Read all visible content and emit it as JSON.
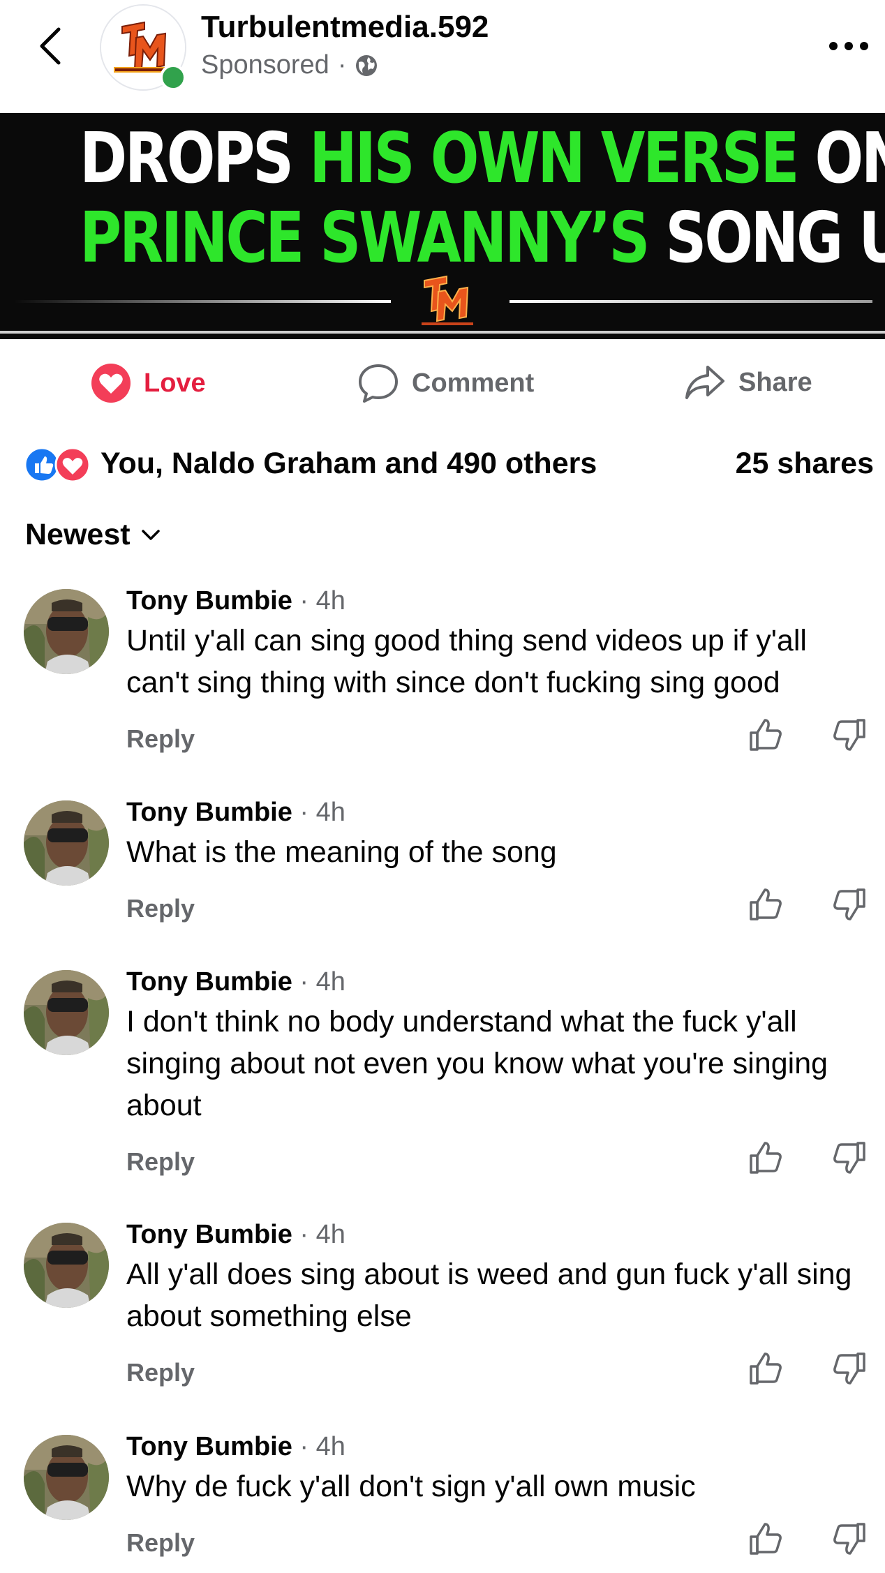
{
  "header": {
    "page_name": "Turbulentmedia.592",
    "sponsored": "Sponsored",
    "separator": "·"
  },
  "banner": {
    "line1": [
      {
        "text": "DROPS ",
        "color": "white"
      },
      {
        "text": "HIS OWN VERSE",
        "color": "green"
      },
      {
        "text": " ON",
        "color": "white"
      }
    ],
    "line2": [
      {
        "text": "PRINCE SWANNY’S",
        "color": "green"
      },
      {
        "text": " SONG UNCLE",
        "color": "white"
      }
    ],
    "logo_text": "TM",
    "colors": {
      "green": "#2ee62b",
      "white": "#ffffff",
      "background": "#0a0a0a"
    }
  },
  "actions": {
    "love": "Love",
    "comment": "Comment",
    "share": "Share",
    "love_color": "#e41e3f"
  },
  "summary": {
    "reactions_text": "You, Naldo Graham and 490 others",
    "shares_text": "25 shares"
  },
  "sort": {
    "label": "Newest"
  },
  "comments": [
    {
      "author": "Tony Bumbie",
      "time": "4h",
      "text": "Until y'all can sing good thing send videos up if y'all can't sing thing with since don't fucking sing good",
      "reply": "Reply"
    },
    {
      "author": "Tony Bumbie",
      "time": "4h",
      "text": "What is the meaning of the song",
      "reply": "Reply"
    },
    {
      "author": "Tony Bumbie",
      "time": "4h",
      "text": "I don't think no body understand what the fuck y'all singing about not even you know what you're singing about",
      "reply": "Reply"
    },
    {
      "author": "Tony Bumbie",
      "time": "4h",
      "text": "All y'all does sing about is weed and gun fuck y'all sing about something else",
      "reply": "Reply"
    },
    {
      "author": "Tony Bumbie",
      "time": "4h",
      "text": "Why de fuck y'all don't sign y'all own music",
      "reply": "Reply"
    }
  ]
}
